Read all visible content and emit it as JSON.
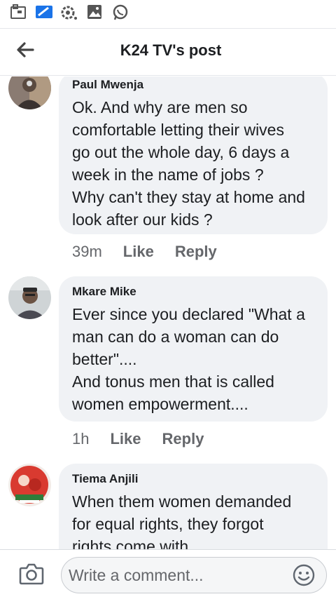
{
  "status_bar": {
    "icons": [
      "sim-card-icon",
      "gallery-icon",
      "settings-gear-icon",
      "image-icon",
      "whatsapp-icon"
    ]
  },
  "header": {
    "title": "K24 TV's post",
    "back_icon": "arrow-left-icon"
  },
  "comments": [
    {
      "author": "Paul Mwenja",
      "text": "Ok. And why are men so\ncomfortable letting their wives\ngo out the whole day,  6 days a\nweek in the name of jobs ?\nWhy can't they stay at home and\nlook after our kids ?",
      "time": "39m",
      "like_label": "Like",
      "reply_label": "Reply"
    },
    {
      "author": "Mkare Mike",
      "text": "Ever since you declared \"What a\nman can do a woman can do\nbetter\"....\nAnd tonus men that is called\nwomen empowerment....",
      "time": "1h",
      "like_label": "Like",
      "reply_label": "Reply"
    },
    {
      "author": "Tiema Anjili",
      "text": "When them women demanded\nfor equal rights, they forgot\nrights come with"
    }
  ],
  "composer": {
    "placeholder": "Write a comment...",
    "camera_icon": "camera-icon",
    "emoji_icon": "emoji-icon"
  },
  "colors": {
    "bubble_bg": "#f0f2f5",
    "meta_text": "#65676b",
    "primary_text": "#1c1e21"
  }
}
